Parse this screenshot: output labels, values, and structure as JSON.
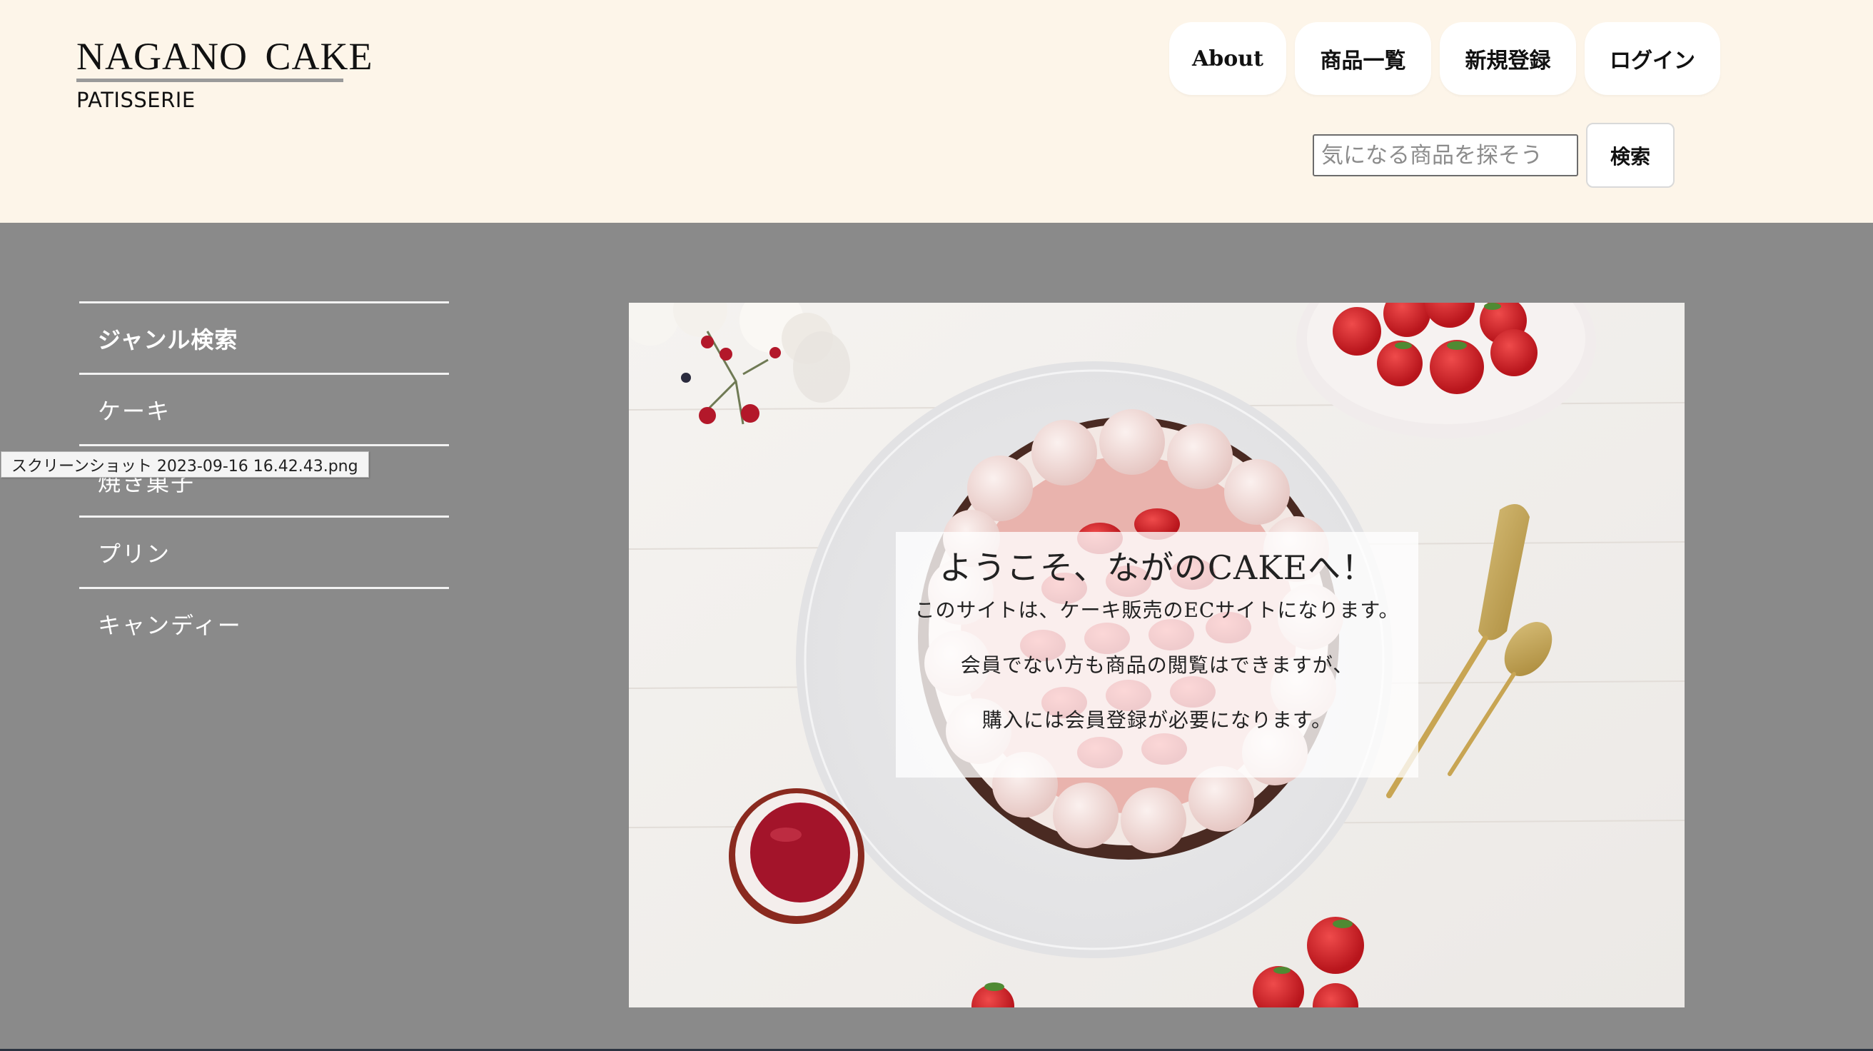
{
  "header": {
    "logo_title": "NAGANO CAKE",
    "logo_subtitle": "PATISSERIE",
    "nav": [
      {
        "label": "About"
      },
      {
        "label": "商品一覧"
      },
      {
        "label": "新規登録"
      },
      {
        "label": "ログイン"
      }
    ],
    "search": {
      "placeholder": "気になる商品を探そう",
      "button_label": "検索"
    },
    "background_color": "#fdf5e9"
  },
  "sidebar": {
    "heading": "ジャンル検索",
    "items": [
      {
        "label": "ケーキ"
      },
      {
        "label": "焼き菓子"
      },
      {
        "label": "プリン"
      },
      {
        "label": "キャンディー"
      }
    ]
  },
  "tooltip": {
    "text": "スクリーンショット 2023-09-16 16.42.43.png"
  },
  "hero": {
    "title": "ようこそ、ながのCAKEへ！",
    "lines": [
      "このサイトは、ケーキ販売のECサイトになります。",
      "会員でない方も商品の閲覧はできますが、",
      "購入には会員登録が必要になります。"
    ]
  },
  "colors": {
    "page_background": "#8a8a8a",
    "header_background": "#fdf5e9",
    "nav_button": "#ffffff",
    "sidebar_text": "#ffffff"
  }
}
